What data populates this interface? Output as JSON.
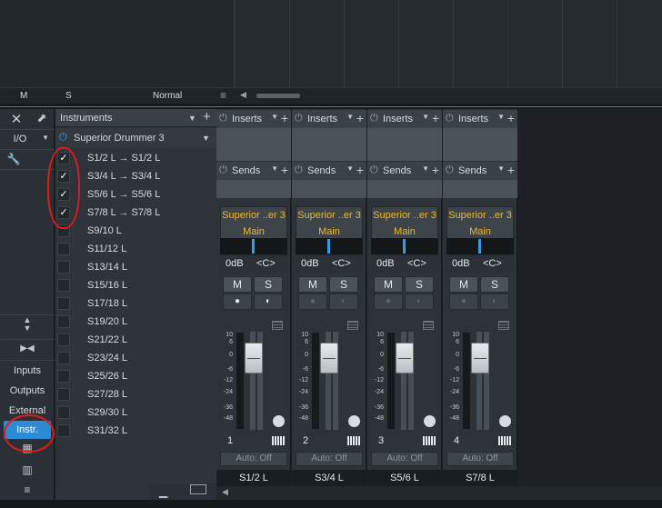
{
  "track_header": {
    "mute_label": "M",
    "solo_label": "S",
    "mode_label": "Normal"
  },
  "left_strip": {
    "io_label": "I/O",
    "inputs_label": "Inputs",
    "outputs_label": "Outputs",
    "external_label": "External",
    "instr_label": "Instr."
  },
  "instrument_panel": {
    "title": "Instruments",
    "device_name": "Superior Drummer 3",
    "outputs": [
      {
        "label": "S1/2 L → S1/2 L",
        "checked": true
      },
      {
        "label": "S3/4 L → S3/4 L",
        "checked": true
      },
      {
        "label": "S5/6 L → S5/6 L",
        "checked": true
      },
      {
        "label": "S7/8 L → S7/8 L",
        "checked": true
      },
      {
        "label": "S9/10 L",
        "checked": false
      },
      {
        "label": "S11/12 L",
        "checked": false
      },
      {
        "label": "S13/14 L",
        "checked": false
      },
      {
        "label": "S15/16 L",
        "checked": false
      },
      {
        "label": "S17/18 L",
        "checked": false
      },
      {
        "label": "S19/20 L",
        "checked": false
      },
      {
        "label": "S21/22 L",
        "checked": false
      },
      {
        "label": "S23/24 L",
        "checked": false
      },
      {
        "label": "S25/26 L",
        "checked": false
      },
      {
        "label": "S27/28 L",
        "checked": false
      },
      {
        "label": "S29/30 L",
        "checked": false
      },
      {
        "label": "S31/32 L",
        "checked": false
      }
    ]
  },
  "mixer": {
    "inserts_label": "Inserts",
    "sends_label": "Sends",
    "mute_label": "M",
    "solo_label": "S",
    "auto_label": "Auto: Off",
    "scale": [
      "10",
      "6",
      "0",
      "-6",
      "-12",
      "-24",
      "-36",
      "-48"
    ],
    "channels": [
      {
        "number": "1",
        "instrument": "Superior ..er 3",
        "output": "Main",
        "gain": "0dB",
        "pan": "<C>",
        "name": "S1/2 L"
      },
      {
        "number": "2",
        "instrument": "Superior ..er 3",
        "output": "Main",
        "gain": "0dB",
        "pan": "<C>",
        "name": "S3/4 L"
      },
      {
        "number": "3",
        "instrument": "Superior ..er 3",
        "output": "Main",
        "gain": "0dB",
        "pan": "<C>",
        "name": "S5/6 L"
      },
      {
        "number": "4",
        "instrument": "Superior ..er 3",
        "output": "Main",
        "gain": "0dB",
        "pan": "<C>",
        "name": "S7/8 L"
      }
    ]
  },
  "colors": {
    "accent_blue": "#2d8bd6",
    "channel_label_yellow": "#f0b82a",
    "annotation_red": "#e01b1b"
  }
}
